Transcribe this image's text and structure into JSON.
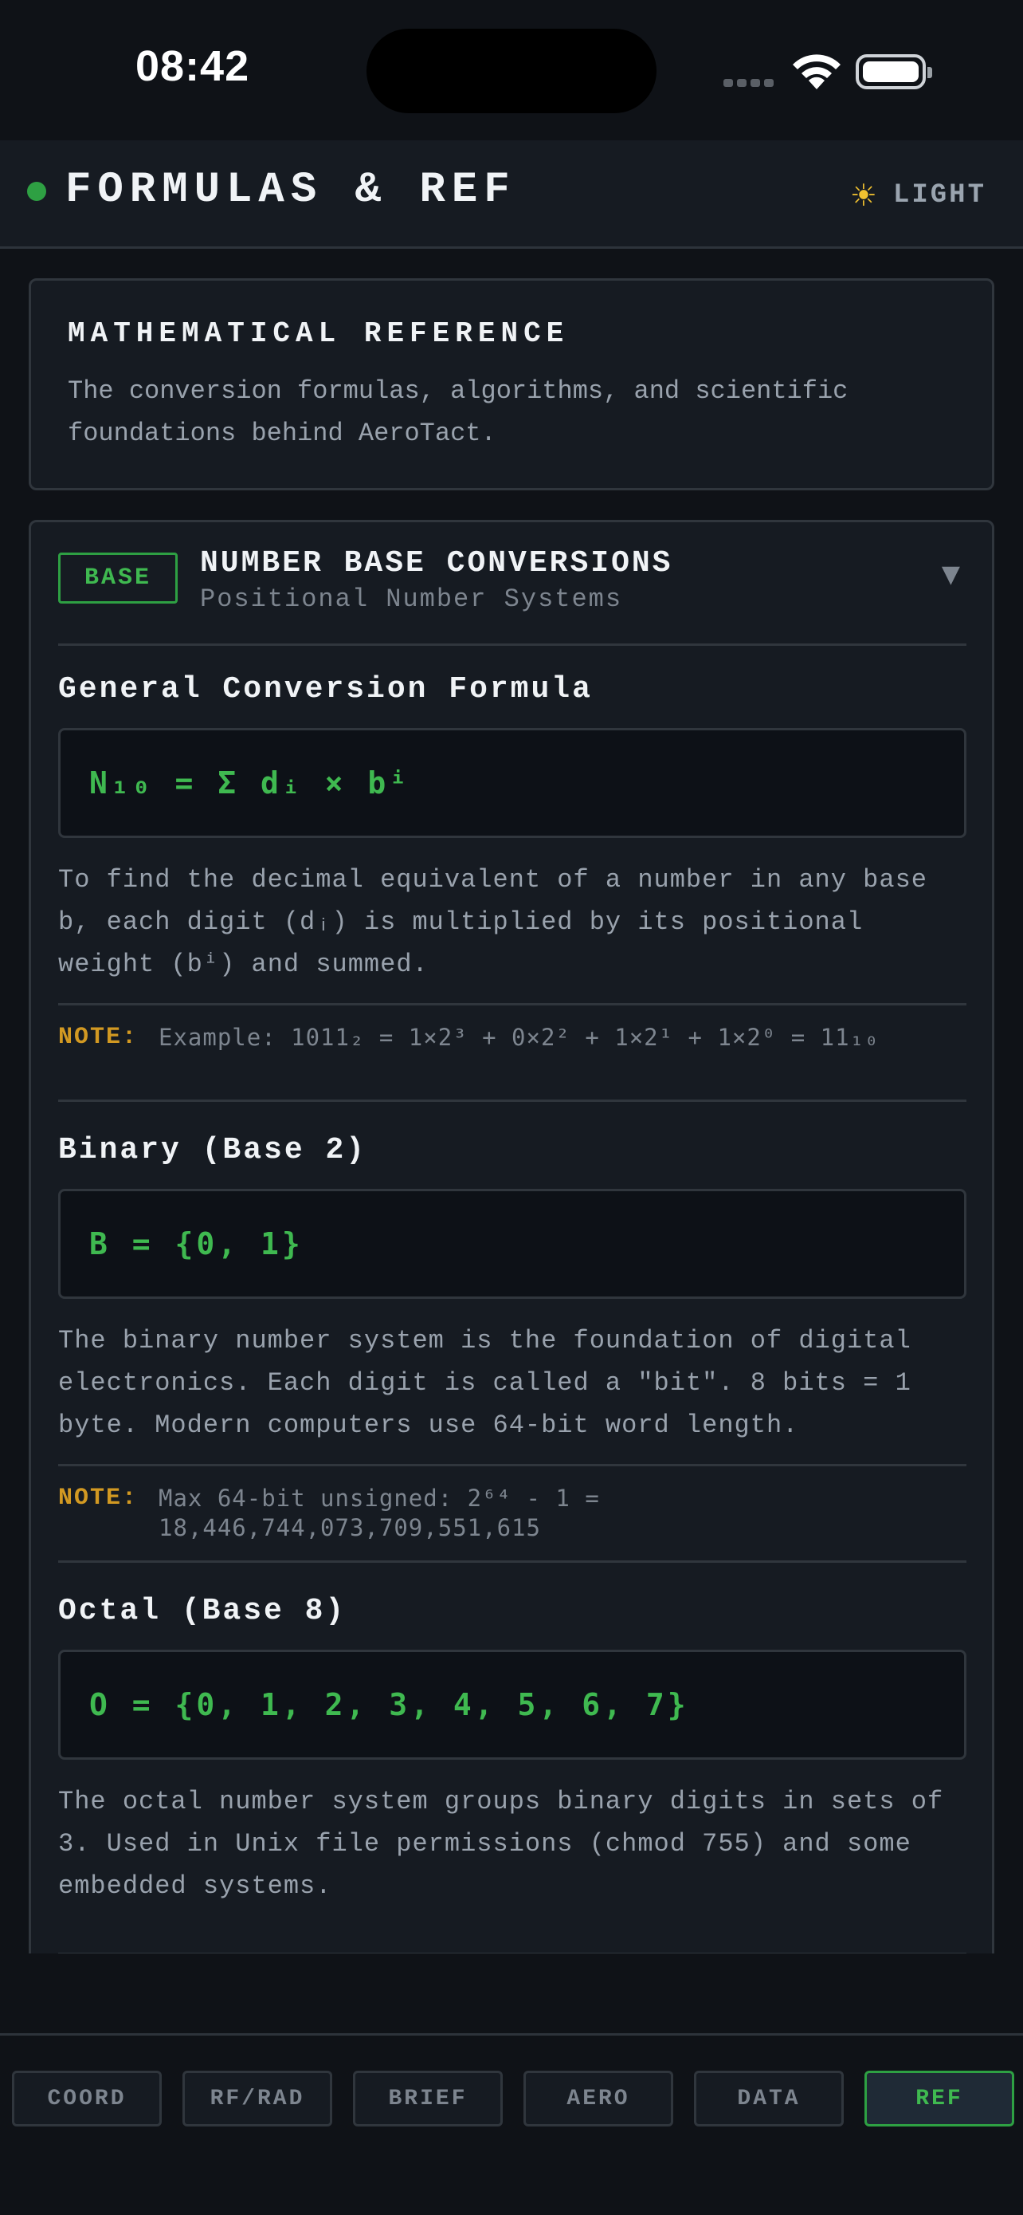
{
  "status": {
    "time": "08:42"
  },
  "header": {
    "title": "FORMULAS & REF",
    "theme_icon": "sun-icon",
    "theme_label": "LIGHT"
  },
  "intro": {
    "title": "MATHEMATICAL REFERENCE",
    "text": "The conversion formulas, algorithms, and scientific foundations behind AeroTact."
  },
  "section": {
    "badge": "BASE",
    "title": "NUMBER BASE CONVERSIONS",
    "subtitle": "Positional Number Systems",
    "items": [
      {
        "title": "General Conversion Formula",
        "formula": "N₁₀ = Σ dᵢ × bⁱ",
        "description": "To find the decimal equivalent of a number in any base b, each digit (dᵢ) is multiplied by its positional weight (bⁱ) and summed.",
        "note_label": "NOTE:",
        "note": "Example: 1011₂ = 1×2³ + 0×2² + 1×2¹ + 1×2⁰ = 11₁₀"
      },
      {
        "title": "Binary (Base 2)",
        "formula": "B = {0, 1}",
        "description": "The binary number system is the foundation of digital electronics. Each digit is called a \"bit\". 8 bits = 1 byte. Modern computers use 64-bit word length.",
        "note_label": "NOTE:",
        "note": "Max 64-bit unsigned: 2⁶⁴ - 1 = 18,446,744,073,709,551,615"
      },
      {
        "title": "Octal (Base 8)",
        "formula": "O = {0, 1, 2, 3, 4, 5, 6, 7}",
        "description": "The octal number system groups binary digits in sets of 3. Used in Unix file permissions (chmod 755) and some embedded systems."
      }
    ]
  },
  "tabs": [
    {
      "label": "COORD",
      "active": false
    },
    {
      "label": "RF/RAD",
      "active": false
    },
    {
      "label": "BRIEF",
      "active": false
    },
    {
      "label": "AERO",
      "active": false
    },
    {
      "label": "DATA",
      "active": false
    },
    {
      "label": "REF",
      "active": true
    }
  ],
  "colors": {
    "background": "#0f1217",
    "card": "#161b22",
    "accent_green": "#3fb950",
    "note_amber": "#d29922"
  }
}
